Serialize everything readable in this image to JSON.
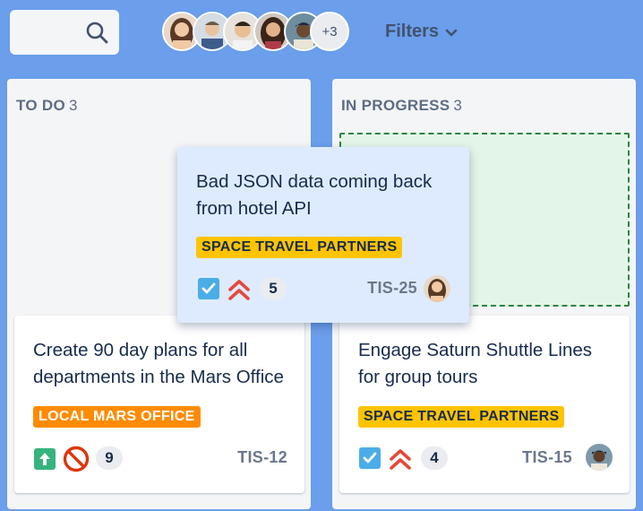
{
  "toolbar": {
    "search_icon": "search-icon",
    "avatars_more": "+3",
    "filters_label": "Filters"
  },
  "columns": [
    {
      "title": "TO DO",
      "count": "3"
    },
    {
      "title": "IN PROGRESS",
      "count": "3"
    }
  ],
  "cards": {
    "dragging": {
      "title": "Bad JSON data coming back from hotel API",
      "label": "SPACE TRAVEL PARTNERS",
      "label_color": "#FFC400",
      "type_icon": "task-checkbox-icon",
      "priority_icon": "highest-priority-icon",
      "points": "5",
      "key": "TIS-25"
    },
    "todo_1": {
      "title": "Create 90 day plans for all departments in the Mars Office",
      "label": "LOCAL MARS OFFICE",
      "label_color": "#FF8B00",
      "type_icon": "improvement-arrow-icon",
      "priority_icon": "blocker-icon",
      "points": "9",
      "key": "TIS-12"
    },
    "inprogress_1": {
      "title": "Engage Saturn Shuttle Lines for group tours",
      "label": "SPACE TRAVEL PARTNERS",
      "label_color": "#FFC400",
      "type_icon": "task-checkbox-icon",
      "priority_icon": "highest-priority-icon",
      "points": "4",
      "key": "TIS-15"
    }
  },
  "colors": {
    "board_background": "#6B9EEB",
    "column_background": "#F4F5F7",
    "drag_card_background": "#DEEBFF",
    "dropzone_border": "#2E8540",
    "priority_red": "#E5493A",
    "task_blue": "#4BADE8"
  }
}
